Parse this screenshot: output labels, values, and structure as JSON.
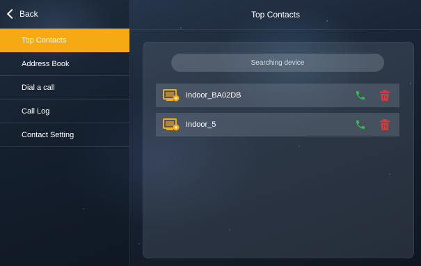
{
  "header": {
    "back_label": "Back",
    "title": "Top Contacts"
  },
  "sidebar": {
    "items": [
      {
        "label": "Top Contacts",
        "active": true
      },
      {
        "label": "Address Book",
        "active": false
      },
      {
        "label": "Dial a call",
        "active": false
      },
      {
        "label": "Call Log",
        "active": false
      },
      {
        "label": "Contact Setting",
        "active": false
      }
    ]
  },
  "main": {
    "search_status": "Searching device",
    "contacts": [
      {
        "name": "Indoor_BA02DB",
        "icon": "indoor-monitor-icon"
      },
      {
        "name": "Indoor_5",
        "icon": "indoor-monitor-icon"
      }
    ]
  },
  "colors": {
    "accent": "#f5a912",
    "call": "#2ec24a",
    "delete": "#e0393b"
  }
}
